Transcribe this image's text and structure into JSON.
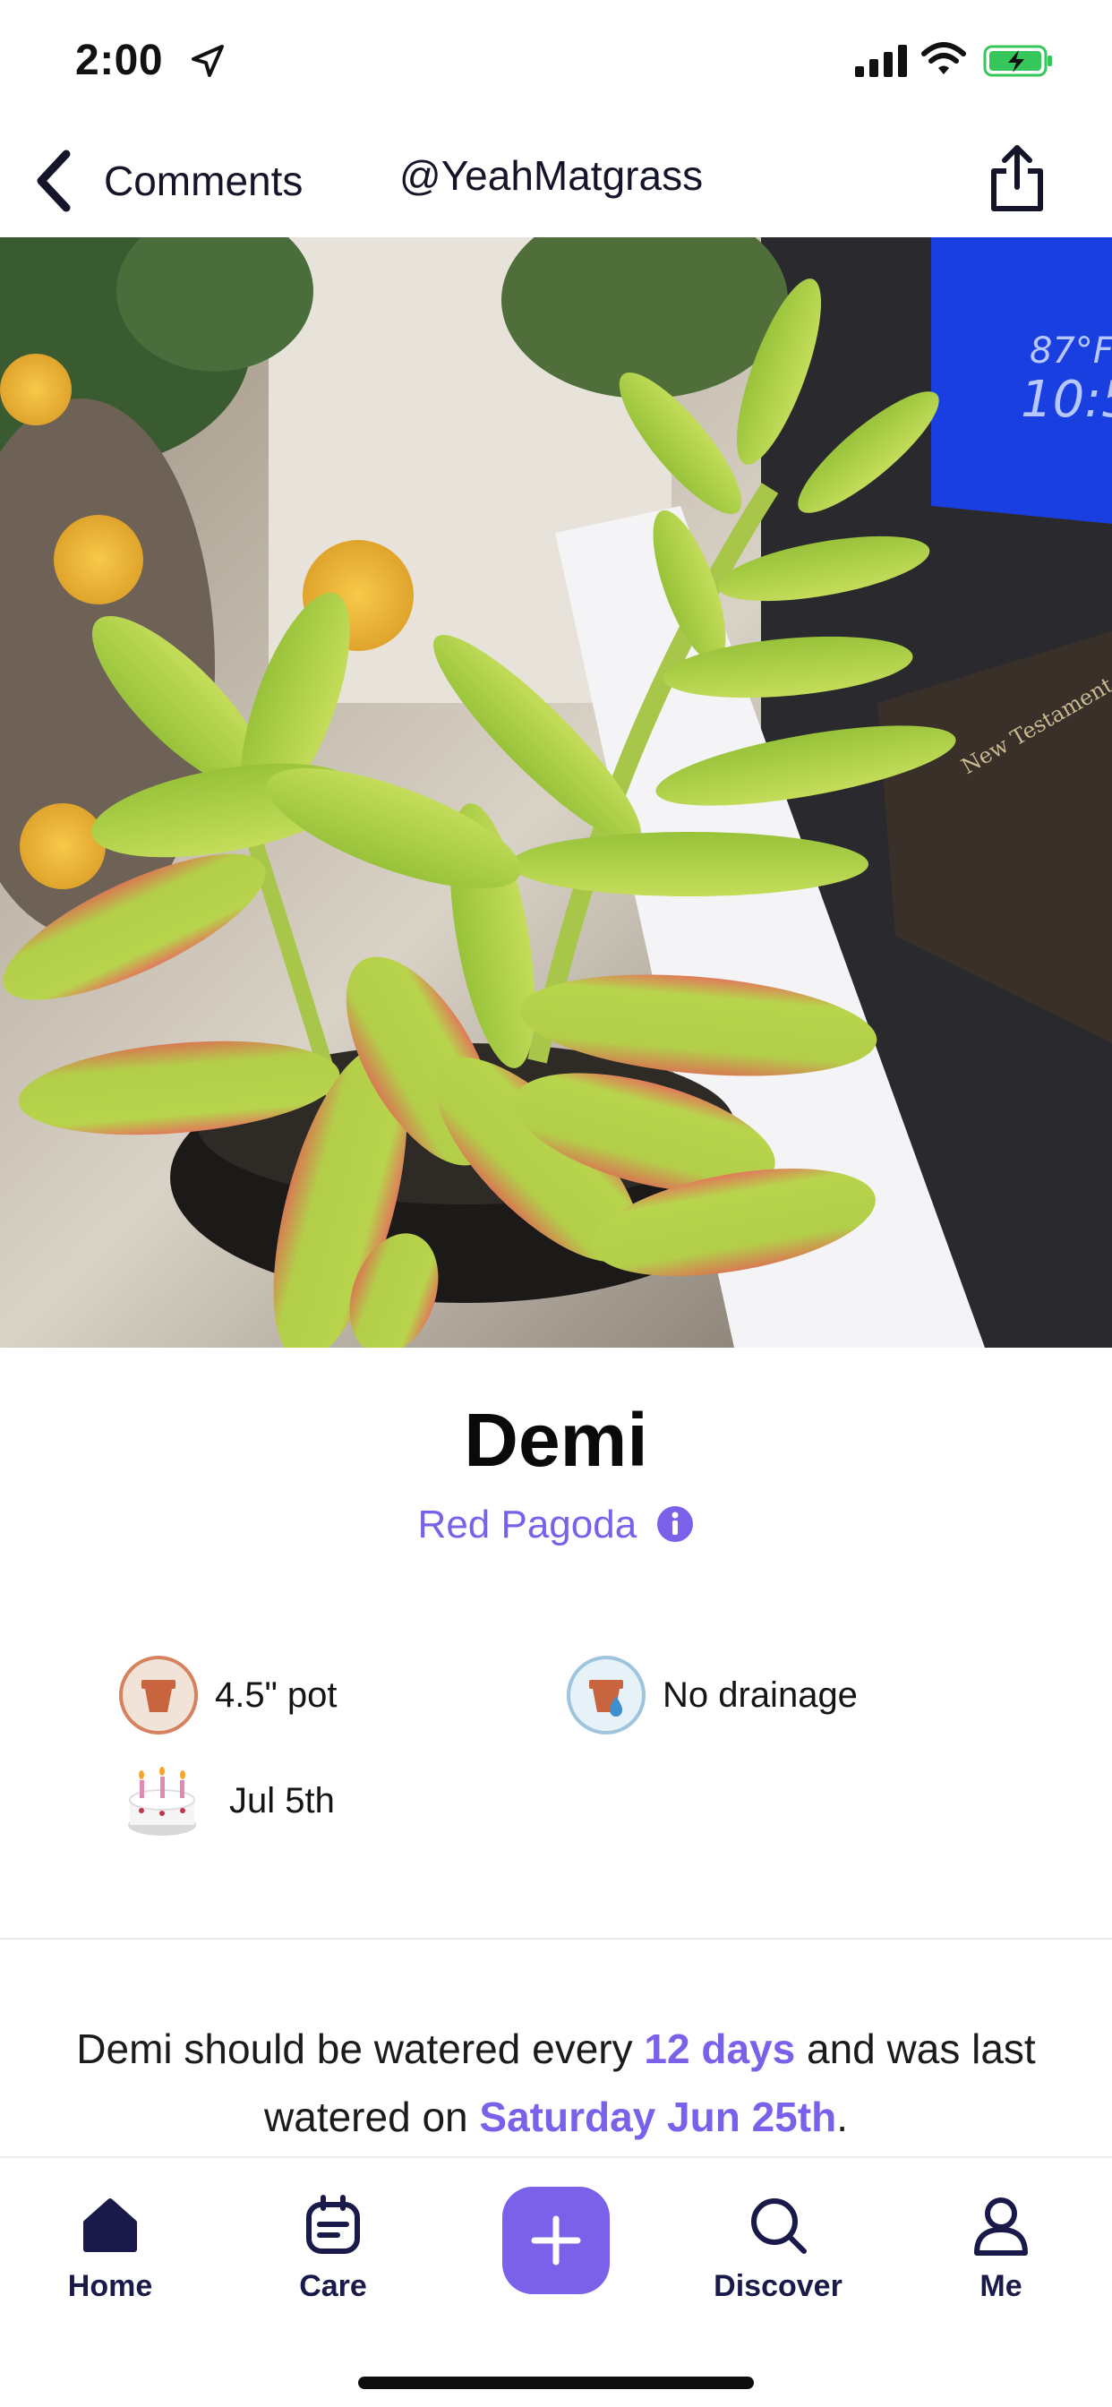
{
  "status_bar": {
    "time": "2:00",
    "location_icon": "location-arrow-icon",
    "signal_icon": "cellular-signal-icon",
    "wifi_icon": "wifi-icon",
    "battery_icon": "battery-charging-icon"
  },
  "nav": {
    "back_label": "Comments",
    "handle": "@YeahMatgrass",
    "share_icon": "share-icon"
  },
  "screen": {
    "top_clock_text": "87°F",
    "top_clock_time": "10:5",
    "book_text": "New Testament"
  },
  "plant": {
    "name": "Demi",
    "species": "Red Pagoda",
    "attributes": {
      "pot": "4.5\" pot",
      "drainage": "No drainage",
      "birthday": "Jul 5th"
    }
  },
  "watering": {
    "prefix": "Demi should be watered every ",
    "interval": "12 days",
    "middle": " and was last watered on ",
    "last_date": "Saturday Jun 25th",
    "suffix": "."
  },
  "tabs": [
    {
      "label": "Home",
      "icon": "home-icon",
      "active": true
    },
    {
      "label": "Care",
      "icon": "care-calendar-icon",
      "active": false
    },
    {
      "label": "Discover",
      "icon": "search-icon",
      "active": false
    },
    {
      "label": "Me",
      "icon": "person-icon",
      "active": false
    }
  ],
  "colors": {
    "accent": "#7b61ea",
    "nav_text": "#15152a",
    "tab_text": "#1a1a4a"
  }
}
